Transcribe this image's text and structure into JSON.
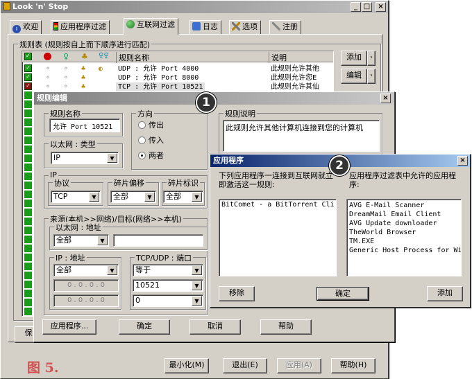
{
  "main": {
    "title": "Look 'n' Stop",
    "tabs": [
      {
        "label": "欢迎",
        "icon": "info-icon"
      },
      {
        "label": "应用程序过滤",
        "icon": "traffic-light-icon"
      },
      {
        "label": "互联网过滤",
        "icon": "globe-icon"
      },
      {
        "label": "日志",
        "icon": "log-icon"
      },
      {
        "label": "选项",
        "icon": "tools-icon"
      },
      {
        "label": "注册",
        "icon": "register-icon"
      }
    ],
    "rules_group_label": "规则表 (规则按自上而下顺序进行匹配)",
    "columns": {
      "name": "规则名称",
      "desc": "说明"
    },
    "rows": [
      {
        "name": "UDP : 允许 Port 4000",
        "desc": "此规则允许其他"
      },
      {
        "name": "UDP : 允许 Port 8000",
        "desc": "此规则允许您E"
      },
      {
        "name": "TCP : 允许 Port 10521",
        "desc": "此规则允许其仙"
      }
    ],
    "side_buttons": {
      "add": "添加",
      "edit": "编辑"
    },
    "bottom_left_fragment": "保",
    "footer_label": "图 5.",
    "footer_buttons": {
      "minimize": "最小化(M)",
      "exit": "退出(E)",
      "apply": "应用(A)",
      "help": "帮助(H)"
    }
  },
  "rule_editor": {
    "title": "规则编辑",
    "badge": "1",
    "name_group": "规则名称",
    "name_value": "允许 Port 10521",
    "direction_group": "方向",
    "direction_options": [
      "传出",
      "传入",
      "两者"
    ],
    "ethernet_group": "以太网 : 类型",
    "ethernet_value": "IP",
    "ip_group": "IP",
    "protocol_group": "协议",
    "protocol_value": "TCP",
    "frag_offset_group": "碎片偏移",
    "frag_offset_value": "全部",
    "frag_flag_group": "碎片标识",
    "frag_flag_value": "全部",
    "src_dst_group": "来源(本机>>网络)/目标(网络>>本机)",
    "eth_addr_group": "以太网 : 地址",
    "eth_addr_value": "全部",
    "ip_addr_group": "IP : 地址",
    "ip_addr_value": "全部",
    "ip_placeholder": "0 . 0 . 0 . 0",
    "port_group": "TCP/UDP : 端口",
    "port_op": "等于",
    "port_value": "10521",
    "port_value2": "0",
    "desc_group": "规则说明",
    "desc_value": "此规则允许其他计算机连接到您的计算机",
    "buttons": {
      "apps": "应用程序...",
      "ok": "确定",
      "cancel": "取消",
      "help": "帮助"
    }
  },
  "app_dialog": {
    "title": "应用程序",
    "badge": "2",
    "left_label": "下列应用程序一连接到互联网就立即激活这一规则:",
    "left_items": [
      "BitComet - a BitTorrent Cli"
    ],
    "right_label": "应用程序过滤表中允许的应用程序:",
    "right_items": [
      "AVG E-Mail Scanner",
      "DreamMail Email Client",
      "AVG Update downloader",
      "TheWorld Browser",
      "TM.EXE",
      "Generic Host Process for Wi"
    ],
    "buttons": {
      "remove": "移除",
      "ok": "确定",
      "add": "添加"
    }
  }
}
